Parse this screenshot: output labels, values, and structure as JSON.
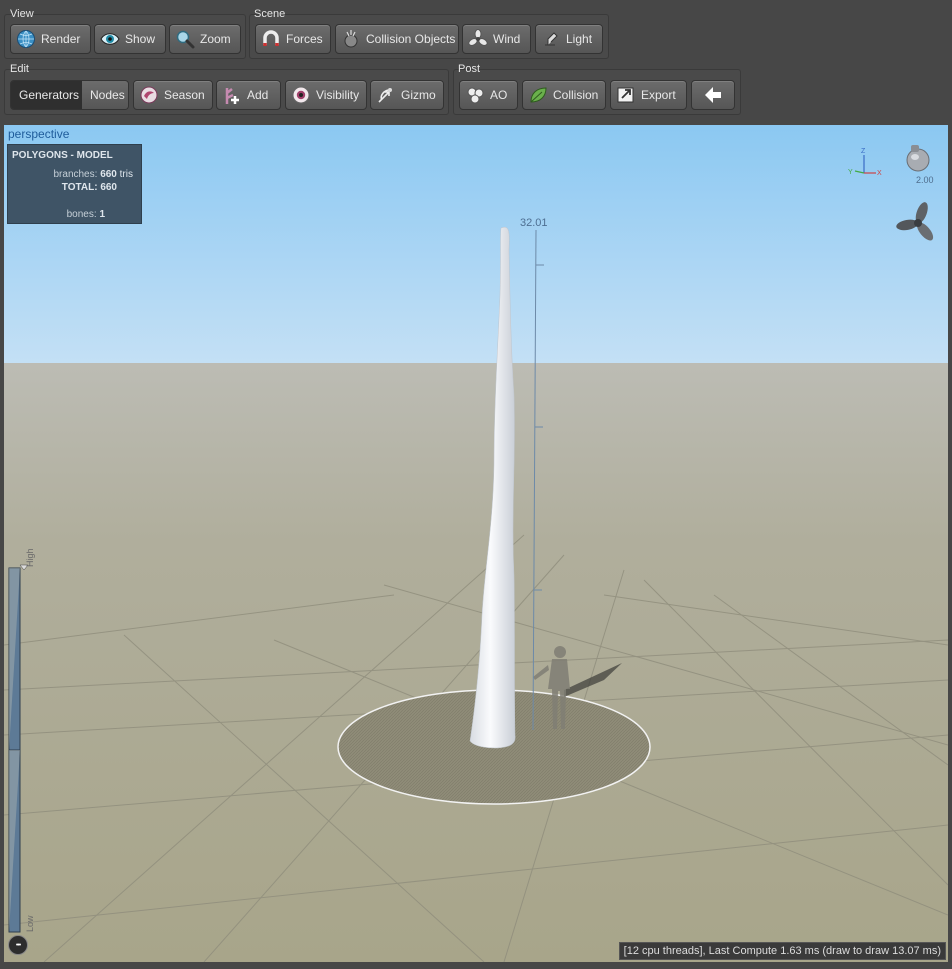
{
  "view_group": {
    "label": "View",
    "render": "Render",
    "show": "Show",
    "zoom": "Zoom"
  },
  "scene_group": {
    "label": "Scene",
    "forces": "Forces",
    "collision_objects": "Collision Objects",
    "wind": "Wind",
    "light": "Light"
  },
  "edit_group": {
    "label": "Edit",
    "generators": "Generators",
    "nodes": "Nodes",
    "season": "Season",
    "add": "Add",
    "visibility": "Visibility",
    "gizmo": "Gizmo"
  },
  "post_group": {
    "label": "Post",
    "ao": "AO",
    "collision": "Collision",
    "export": "Export"
  },
  "viewport": {
    "camera_label": "perspective",
    "height_readout": "32.01",
    "light_intensity": "2.00",
    "lod_high": "High",
    "lod_low": "Low",
    "more": "•••",
    "status": "[12 cpu threads], Last Compute 1.63 ms (draw to draw 13.07 ms)"
  },
  "stats": {
    "title": "POLYGONS - MODEL",
    "branches_label": "branches:",
    "branches_value": "660",
    "branches_unit": "tris",
    "total_label": "TOTAL:",
    "total_value": "660",
    "bones_label": "bones:",
    "bones_value": "1"
  },
  "colors": {
    "toolbar_bg": "#474747",
    "sky_top": "#8ec9f2",
    "ground": "#a9a58d",
    "stats_bg": "#3f5466",
    "trunk": "#f2f4f7"
  }
}
